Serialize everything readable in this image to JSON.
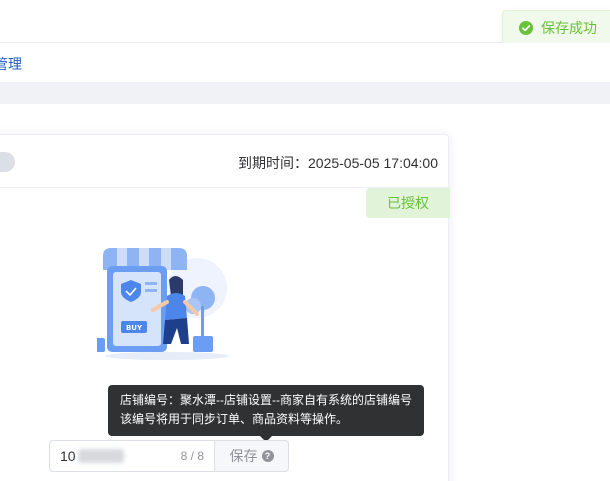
{
  "toast": {
    "message": "保存成功",
    "icon": "check-circle-icon",
    "color": "#67c23a"
  },
  "nav": {
    "link_label": "管理"
  },
  "card": {
    "expire_label": "到期时间：",
    "expire_value": "2025-05-05 17:04:00",
    "auth_badge": "已授权",
    "illustration": "shop-buy-illustration"
  },
  "tooltip": {
    "line1": "店铺编号：聚水潭--店铺设置--商家自有系统的店铺编号",
    "line2": "该编号将用于同步订单、商品资料等操作。"
  },
  "store_input": {
    "value_prefix": "10",
    "counter": "8 / 8",
    "save_label": "保存",
    "help_icon": "question-circle-icon"
  }
}
